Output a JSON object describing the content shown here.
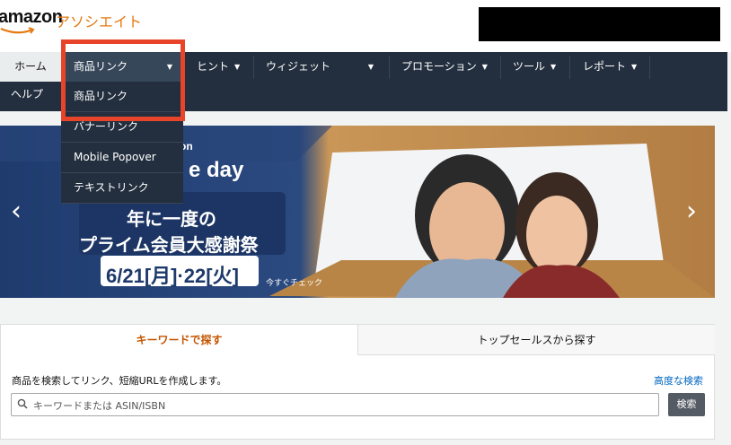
{
  "header": {
    "logo_amazon": "amazon",
    "logo_associates": "アソシエイト",
    "accent_color": "#e47911"
  },
  "nav": {
    "items": [
      {
        "label": "ホーム"
      },
      {
        "label": "商品リンク"
      },
      {
        "label": "ヒント"
      },
      {
        "label": "ウィジェット"
      },
      {
        "label": "プロモーション"
      },
      {
        "label": "ツール"
      },
      {
        "label": "レポート"
      }
    ],
    "help": "ヘルプ",
    "caret": "▼"
  },
  "dropdown": {
    "items": [
      {
        "label": "商品リンク"
      },
      {
        "label": "バナーリンク"
      },
      {
        "label": "Mobile Popover"
      },
      {
        "label": "テキストリンク"
      }
    ]
  },
  "banner": {
    "brand_partial": "on",
    "title_partial": "e day",
    "line1": "年に一度の",
    "line2": "プライム会員大感謝祭",
    "date": "6/21[月]·22[火]",
    "cta": "今すぐチェック",
    "prev_arrow": "‹",
    "next_arrow": "›"
  },
  "search": {
    "tabs": [
      {
        "label": "キーワードで探す"
      },
      {
        "label": "トップセールスから探す"
      }
    ],
    "description": "商品を検索してリンク、短縮URLを作成します。",
    "advanced_link": "高度な検索",
    "placeholder": "キーワードまたは ASIN/ISBN",
    "button": "検索",
    "icon": "search-icon"
  },
  "highlight_color": "#e8442a"
}
